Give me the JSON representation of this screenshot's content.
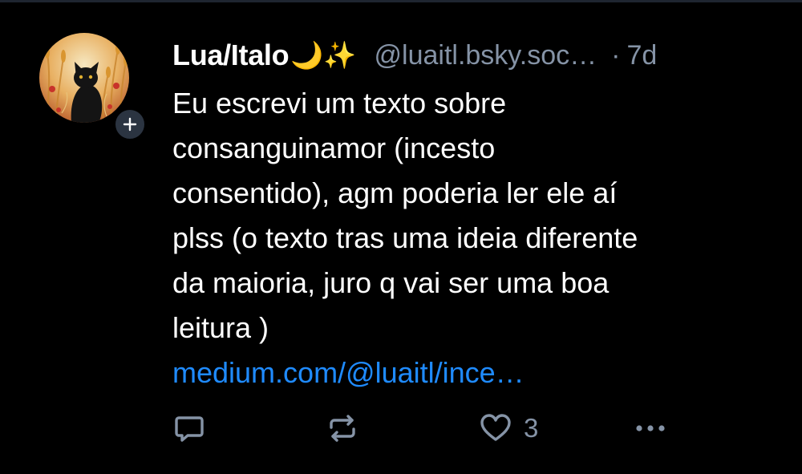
{
  "post": {
    "author": {
      "display_name": "Lua/Italo",
      "emoji": "🌙✨",
      "handle": "@luaitl.bsky.soc…",
      "avatar_icon": "avatar-black-cat-in-wheat-field"
    },
    "time_separator": "·",
    "time": "7d",
    "text_lines": [
      "Eu escrevi um texto sobre",
      "consanguinamor (incesto",
      "consentido), agm poderia ler ele aí",
      "plss (o texto tras uma ideia diferente",
      "da maioria, juro q vai ser uma boa",
      "leitura )"
    ],
    "link_text": "medium.com/@luaitl/ince…",
    "follow_icon": "plus-icon",
    "actions": {
      "reply_icon": "reply-bubble-icon",
      "repost_icon": "repost-icon",
      "like_icon": "heart-icon",
      "like_count": "3",
      "more_icon": "more-dots-icon"
    }
  },
  "colors": {
    "background": "#000000",
    "text": "#ffffff",
    "muted": "#8593a6",
    "link": "#1f8bff",
    "badge": "#2b3441"
  }
}
